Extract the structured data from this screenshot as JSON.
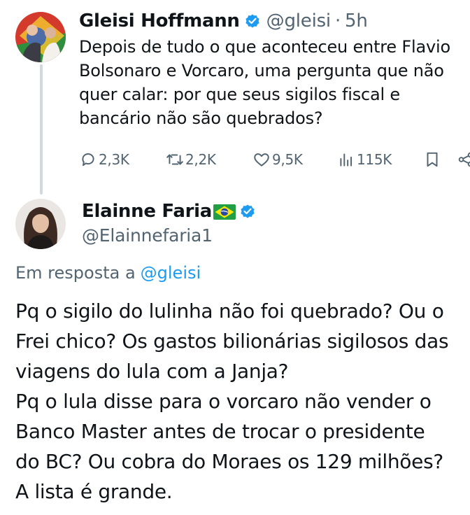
{
  "quoted_tweet": {
    "author_name": "Gleisi Hoffmann",
    "handle": "@gleisi",
    "separator": "·",
    "time": "5h",
    "verified_icon": "verified-badge-icon",
    "text_lines": [
      "Depois de tudo o que aconteceu entre Flavio",
      "Bolsonaro e Vorcaro, uma pergunta que não",
      "quer calar: por que seus sigilos fiscal e",
      "bancário não são quebrados?"
    ],
    "actions": {
      "replies": "2,3K",
      "reposts": "2,2K",
      "likes": "9,5K",
      "views": "115K"
    }
  },
  "reply_tweet": {
    "author_name": "Elainne Faria",
    "flag_icon": "brazil-flag-icon",
    "handle": "@Elainnefaria1",
    "reply_prefix": "Em resposta a",
    "reply_to": "@gleisi",
    "text_lines": [
      "Pq o sigilo do lulinha não foi quebrado? Ou o",
      "Frei chico?  Os gastos bilionárias sigilosos das",
      "viagens do lula com a Janja?",
      "Pq o lula disse para o vorcaro não vender o",
      "Banco Master antes de trocar o presidente",
      "do BC? Ou cobra do Moraes os 129 milhões?",
      "A lista é grande."
    ]
  },
  "colors": {
    "text": "#0f1419",
    "muted": "#536471",
    "accent": "#1d9bf0",
    "thread_line": "#cfd9de"
  }
}
